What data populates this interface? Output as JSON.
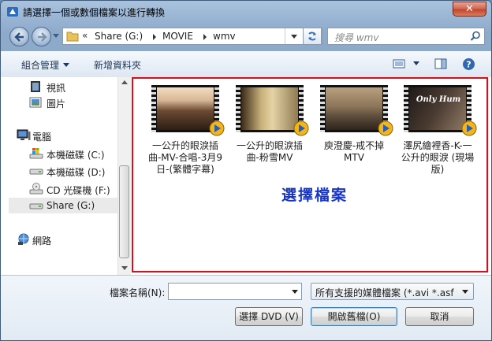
{
  "window": {
    "title": "請選擇一個或數個檔案以進行轉換"
  },
  "address": {
    "prefix": "«",
    "crumbs": [
      "Share (G:)",
      "MOVIE",
      "wmv"
    ]
  },
  "search": {
    "placeholder": "搜尋 wmv"
  },
  "toolbar": {
    "organize": "組合管理",
    "new_folder": "新增資料夾"
  },
  "sidebar": {
    "items": [
      {
        "label": "視訊",
        "icon": "video-library-icon"
      },
      {
        "label": "圖片",
        "icon": "pictures-library-icon"
      },
      {
        "label": "電腦",
        "icon": "computer-icon"
      },
      {
        "label": "本機磁碟 (C:)",
        "icon": "windows-drive-icon"
      },
      {
        "label": "本機磁碟 (D:)",
        "icon": "hard-drive-icon"
      },
      {
        "label": "CD 光碟機 (F:)",
        "icon": "cd-drive-icon"
      },
      {
        "label": "Share (G:)",
        "icon": "hard-drive-icon",
        "selected": true
      },
      {
        "label": "網路",
        "icon": "network-icon"
      }
    ]
  },
  "files": [
    {
      "name": "一公升的眼淚插曲-MV-合唱-3月9日-(繁體字幕)"
    },
    {
      "name": "一公升的眼淚插曲-粉雪MV"
    },
    {
      "name": "庾澄慶-戒不掉MTV"
    },
    {
      "name": "澤尻繪裡香-K-一公升的眼淚 (現場版)",
      "thumb_text": "Only Hum"
    }
  ],
  "annotation": "選擇檔案",
  "bottom": {
    "filename_label": "檔案名稱(N):",
    "filename_value": "",
    "filter_value": "所有支援的媒體檔案 (*.avi *.asf *.r",
    "dvd_button": "選擇 DVD (V)",
    "open_button": "開啟舊檔(O)",
    "cancel_button": "取消"
  }
}
